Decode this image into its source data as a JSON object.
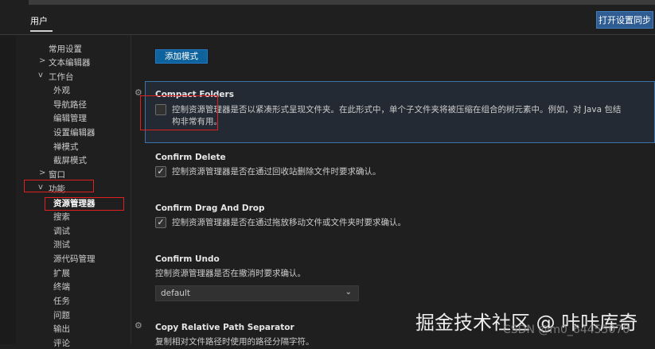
{
  "header": {
    "user_tab": "用户",
    "sync_button": "打开设置同步"
  },
  "sidebar": {
    "items": [
      {
        "label": "常用设置"
      },
      {
        "label": "文本编辑器"
      },
      {
        "label": "工作台"
      },
      {
        "label": "外观"
      },
      {
        "label": "导航路径"
      },
      {
        "label": "编辑管理"
      },
      {
        "label": "设置编辑器"
      },
      {
        "label": "禅模式"
      },
      {
        "label": "截屏模式"
      },
      {
        "label": "窗口"
      },
      {
        "label": "功能"
      },
      {
        "label": "资源管理器"
      },
      {
        "label": "搜索"
      },
      {
        "label": "调试"
      },
      {
        "label": "测试"
      },
      {
        "label": "源代码管理"
      },
      {
        "label": "扩展"
      },
      {
        "label": "终端"
      },
      {
        "label": "任务"
      },
      {
        "label": "问题"
      },
      {
        "label": "输出"
      },
      {
        "label": "评论"
      }
    ]
  },
  "main": {
    "add_pattern_button": "添加模式",
    "compact_folders": {
      "title": "Compact Folders",
      "description": "控制资源管理器是否以紧凑形式呈现文件夹。在此形式中，单个子文件夹将被压缩在组合的树元素中。例如，对 Java 包结构非常有用。",
      "checked": false
    },
    "confirm_delete": {
      "title": "Confirm Delete",
      "description": "控制资源管理器是否在通过回收站删除文件时要求确认。",
      "checked": true
    },
    "confirm_drag": {
      "title": "Confirm Drag And Drop",
      "description": "控制资源管理器是否在通过拖放移动文件或文件夹时要求确认。",
      "checked": true
    },
    "confirm_undo": {
      "title": "Confirm Undo",
      "description": "控制资源管理器是否在撤消时要求确认。",
      "select_value": "default"
    },
    "copy_relative": {
      "title": "Copy Relative Path Separator",
      "description": "复制相对文件路径时使用的路径分隔字符。"
    }
  },
  "watermark": {
    "main": "掘金技术社区 @ 咔咔库奇",
    "small": "CSDN @m0_64455070"
  },
  "colors": {
    "accent": "#0e639c",
    "focus_border": "#3b74a8",
    "annotation_red": "#e02020"
  }
}
